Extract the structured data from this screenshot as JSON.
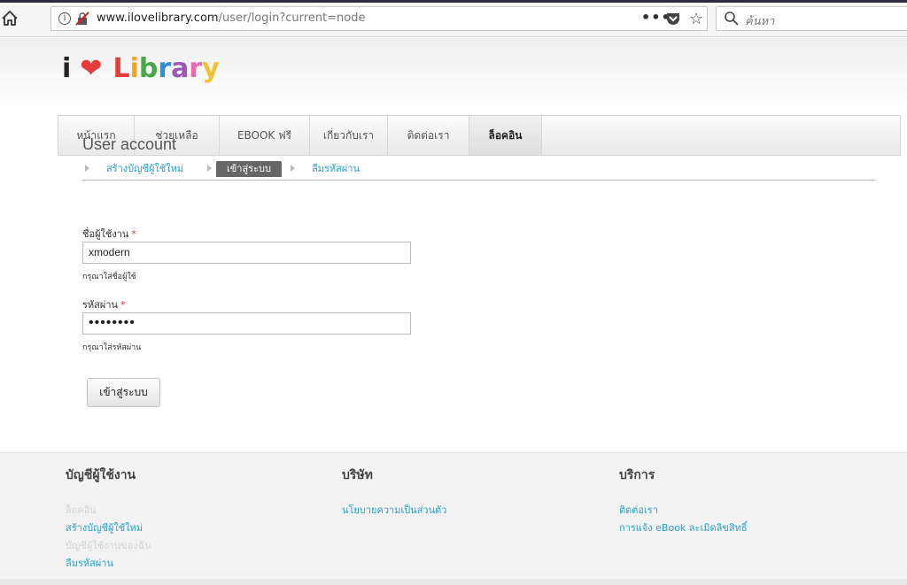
{
  "browser": {
    "url_host": "www.ilovelibrary.com",
    "url_path": "/user/login?current=node",
    "menu_dots": "•••",
    "search_placeholder": "ค้นหา"
  },
  "site": {
    "logo": {
      "i": "i",
      "heart": "❤",
      "word": "Library",
      "letter_colors": [
        "#e23b3b",
        "#f2a51a",
        "#4aa84a",
        "#2f8fd8",
        "#9b59b6",
        "#e86ab0",
        "#f2c12e"
      ]
    },
    "nav": [
      {
        "label": "หน้าแรก",
        "active": false
      },
      {
        "label": "ช่วยเหลือ",
        "active": false
      },
      {
        "label": "EBOOK ฟรี",
        "active": false
      },
      {
        "label": "เกี่ยวกับเรา",
        "active": false
      },
      {
        "label": "ติดต่อเรา",
        "active": false
      },
      {
        "label": "ล็อคอิน",
        "active": true
      }
    ]
  },
  "main": {
    "title": "User account",
    "tabs": [
      {
        "label": "สร้างบัญชีผู้ใช้ใหม่"
      },
      {
        "label": "เข้าสู่ระบบ"
      },
      {
        "label": "ลืมรหัสผ่าน"
      }
    ],
    "username": {
      "label": "ชื่อผู้ใช้งาน",
      "required_mark": "*",
      "value": "xmodern",
      "description": "กรุณาใส่ชื่อผู้ใช้"
    },
    "password": {
      "label": "รหัสผ่าน",
      "required_mark": "*",
      "masked_value": "••••••••",
      "description": "กรุณาใส่รหัสผ่าน"
    },
    "submit_label": "เข้าสู่ระบบ"
  },
  "footer": {
    "columns": [
      {
        "heading": "บัญชีผู้ใช้งาน",
        "links": [
          {
            "label": "ล็อคอิน",
            "dim": true
          },
          {
            "label": "สร้างบัญชีผู้ใช้ใหม่",
            "dim": false
          },
          {
            "label": "บัญชีผู้ใช้งานของฉัน",
            "dim": true
          },
          {
            "label": "ลืมรหัสผ่าน",
            "dim": false
          }
        ]
      },
      {
        "heading": "บริษัท",
        "links": [
          {
            "label": "นโยบายความเป็นส่วนตัว",
            "dim": false
          }
        ]
      },
      {
        "heading": "บริการ",
        "links": [
          {
            "label": "ติดต่อเรา",
            "dim": false
          },
          {
            "label": "การแจ้ง eBook ละเมิดลิขสิทธิ์",
            "dim": false
          }
        ]
      }
    ]
  },
  "colors": {
    "link": "#2aa0c8",
    "required": "#d04040",
    "active_tab_bg": "#666666"
  }
}
